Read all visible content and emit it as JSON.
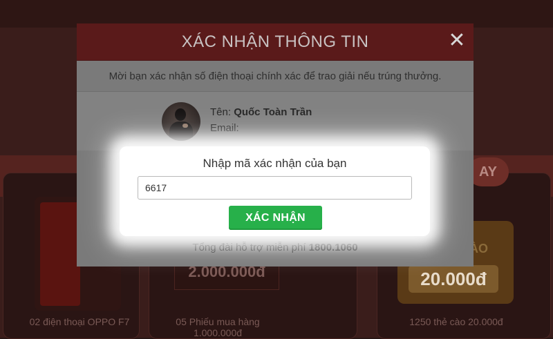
{
  "background": {
    "pill_text": "AY",
    "voucher_text": "2.000.000đ",
    "gold_label": "ÀO",
    "gold_amount": "20.000đ",
    "captions": [
      "02 điện thoại OPPO F7",
      "05 Phiếu mua hàng 1.000.000đ",
      "1250 thẻ cào 20.000đ"
    ]
  },
  "modal": {
    "title": "XÁC NHẬN THÔNG TIN",
    "close_symbol": "✕",
    "subtitle": "Mời bạn xác nhận số điện thoại chính xác để trao giải nếu trúng thưởng.",
    "profile": {
      "name_label": "Tên:",
      "name_value": "Quốc Toàn Trần",
      "email_label": "Email:",
      "email_value": ""
    },
    "code_prompt": "Nhập mã xác nhận của bạn",
    "code_value": "6617",
    "confirm_label": "XÁC NHẬN",
    "hotline_text": "Tổng đài hỗ trợ miễn phí",
    "hotline_number": "1800.1060"
  },
  "colors": {
    "header_bg": "#5a1a1a",
    "confirm_green": "#27b04a",
    "overlay_gray": "#7a7a7a"
  },
  "icons": {
    "close": "close-icon",
    "avatar": "user-avatar-photo"
  }
}
